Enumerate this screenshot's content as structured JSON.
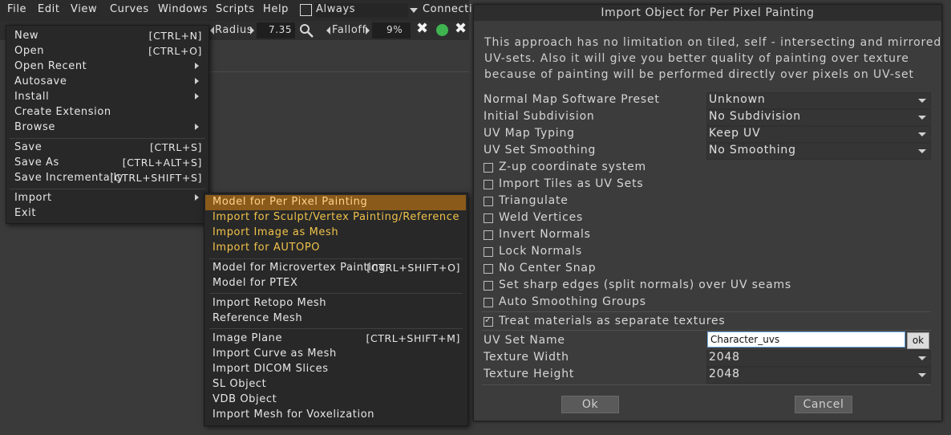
{
  "menubar": {
    "items": [
      "File",
      "Edit",
      "View",
      "Curves",
      "Windows",
      "Scripts",
      "Help"
    ],
    "always_label": "Always",
    "connect_label": "Connecti"
  },
  "toolbar": {
    "radius_label": "Radius",
    "radius_value": "7.35",
    "falloff_label": "Falloff",
    "falloff_value": "9%"
  },
  "file_menu": {
    "groups": [
      [
        {
          "label": "New",
          "shortcut": "[CTRL+N]"
        },
        {
          "label": "Open",
          "shortcut": "[CTRL+O]"
        },
        {
          "label": "Open Recent",
          "submenu": true
        },
        {
          "label": "Autosave",
          "submenu": true
        },
        {
          "label": "Install",
          "submenu": true
        },
        {
          "label": "Create Extension"
        },
        {
          "label": "Browse",
          "submenu": true
        }
      ],
      [
        {
          "label": "Save",
          "shortcut": "[CTRL+S]"
        },
        {
          "label": "Save As",
          "shortcut": "[CTRL+ALT+S]"
        },
        {
          "label": "Save Incrementally",
          "shortcut": "[CTRL+SHIFT+S]"
        }
      ],
      [
        {
          "label": "Import",
          "submenu": true
        },
        {
          "label": "Exit"
        }
      ]
    ]
  },
  "import_menu": {
    "groups": [
      [
        {
          "label": "Model for Per Pixel Painting",
          "highlighted": true
        },
        {
          "label": "Import for Sculpt/Vertex Painting/Reference",
          "accent": true
        },
        {
          "label": "Import Image as Mesh",
          "accent": true
        },
        {
          "label": "Import for AUTOPO",
          "accent": true
        }
      ],
      [
        {
          "label": "Model for Microvertex Painting",
          "shortcut": "[CTRL+SHIFT+O]"
        },
        {
          "label": "Model for PTEX"
        }
      ],
      [
        {
          "label": "Import Retopo Mesh"
        },
        {
          "label": "Reference Mesh"
        }
      ],
      [
        {
          "label": "Image Plane",
          "shortcut": "[CTRL+SHIFT+M]"
        },
        {
          "label": "Import Curve as Mesh"
        },
        {
          "label": "Import DICOM Slices"
        },
        {
          "label": "SL Object"
        },
        {
          "label": "VDB Object"
        },
        {
          "label": "Import Mesh for Voxelization"
        }
      ]
    ]
  },
  "dialog": {
    "title": "Import Object for Per Pixel Painting",
    "description_lines": [
      "This approach has no limitation on tiled, self - intersecting and mirrored",
      "UV-sets. Also it will give you better quality of painting over texture",
      "because of painting will be performed directly over pixels on UV-set"
    ],
    "selects": [
      {
        "label": "Normal Map Software Preset",
        "value": "Unknown"
      },
      {
        "label": "Initial Subdivision",
        "value": "No Subdivision"
      },
      {
        "label": "UV Map Typing",
        "value": "Keep UV"
      },
      {
        "label": "UV Set Smoothing",
        "value": "No Smoothing"
      }
    ],
    "checkboxes": [
      {
        "label": "Z-up coordinate system",
        "checked": false
      },
      {
        "label": "Import Tiles as UV Sets",
        "checked": false
      },
      {
        "label": "Triangulate",
        "checked": false
      },
      {
        "label": "Weld Vertices",
        "checked": false
      },
      {
        "label": "Invert Normals",
        "checked": false
      },
      {
        "label": "Lock Normals",
        "checked": false
      },
      {
        "label": "No Center Snap",
        "checked": false
      },
      {
        "label": "Set sharp edges (split normals) over UV seams",
        "checked": false
      },
      {
        "label": "Auto Smoothing Groups",
        "checked": false
      }
    ],
    "treat_materials": {
      "label": "Treat materials as separate textures",
      "checked": true
    },
    "uv_set_name": {
      "label": "UV Set Name",
      "value": "Character_uvs",
      "ok_label": "ok"
    },
    "texture_width": {
      "label": "Texture Width",
      "value": "2048"
    },
    "texture_height": {
      "label": "Texture Height",
      "value": "2048"
    },
    "ok_label": "Ok",
    "cancel_label": "Cancel"
  }
}
